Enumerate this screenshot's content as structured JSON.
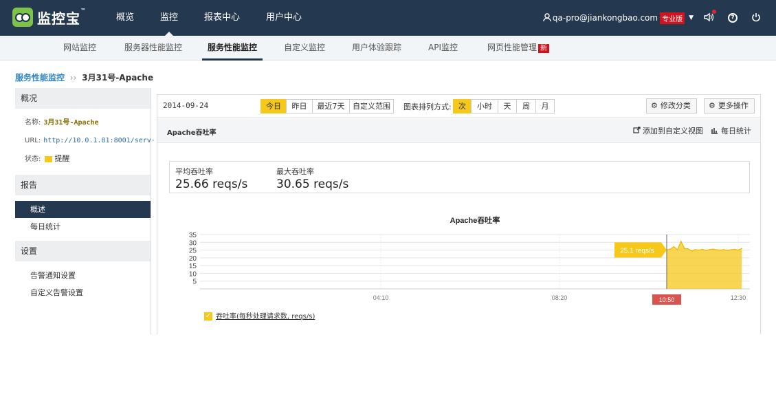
{
  "app": {
    "logo_text": "监控宝",
    "logo_tm": "™",
    "main_nav": [
      "概览",
      "监控",
      "报表中心",
      "用户中心"
    ],
    "main_nav_active": "监控",
    "user_email": "qa-pro@jiankongbao.com",
    "edition_badge": "专业版",
    "help_icon_char": "?"
  },
  "sub_nav": {
    "items": [
      "网站监控",
      "服务器性能监控",
      "服务性能监控",
      "自定义监控",
      "用户体验跟踪",
      "API监控",
      "网页性能管理"
    ],
    "active": "服务性能监控",
    "new_badge": "新"
  },
  "breadcrumb": {
    "parent": "服务性能监控",
    "separator": "››",
    "current": "3月31号-Apache"
  },
  "sidebar": {
    "overview_head": "概况",
    "name_label": "名称:",
    "name_value": "3月31号-Apache",
    "url_label": "URL:",
    "url_value": "http://10.0.1.81:8001/serv···",
    "status_label": "状态:",
    "status_value": "提醒",
    "status_color": "#f5c81a",
    "report_head": "报告",
    "report_items": [
      "概述",
      "每日统计"
    ],
    "report_active": "概述",
    "settings_head": "设置",
    "settings_items": [
      "告警通知设置",
      "自定义告警设置"
    ]
  },
  "toolbar": {
    "date": "2014-09-24",
    "ranges": [
      "今日",
      "昨日",
      "最近7天",
      "自定义范围"
    ],
    "range_active": "今日",
    "sort_label": "图表排列方式:",
    "sort_options": [
      "次",
      "小时",
      "天",
      "周",
      "月"
    ],
    "sort_active": "次",
    "edit_category": "修改分类",
    "more_actions": "更多操作"
  },
  "panel": {
    "title": "Apache吞吐率",
    "add_view": "添加到自定义视图",
    "daily_stats": "每日统计"
  },
  "stats": {
    "avg_label": "平均吞吐率",
    "avg_value": "25.66 reqs/s",
    "max_label": "最大吞吐率",
    "max_value": "30.65 reqs/s"
  },
  "accent_color": "#f5c81a",
  "nav_color": "#24384f",
  "chart_data": {
    "type": "area",
    "title": "Apache吞吐率",
    "yticks": [
      35,
      30,
      25,
      20,
      15,
      10,
      5
    ],
    "ylim": [
      0,
      35
    ],
    "xtick_labels": [
      "04:10",
      "08:20",
      "12:30"
    ],
    "cursor_label": "10:50",
    "tooltip": "25.1 reqs/s",
    "legend": "吞吐率(每秒处理请求数, reqs/s)",
    "series": [
      {
        "x": [
          "10:50",
          "10:55",
          "11:00",
          "11:05",
          "11:10",
          "11:15",
          "11:20",
          "11:25",
          "11:30",
          "11:35",
          "11:40",
          "11:45",
          "11:50",
          "11:55",
          "12:00",
          "12:05",
          "12:10",
          "12:15",
          "12:20",
          "12:25",
          "12:30",
          "12:35"
        ],
        "values": [
          25.1,
          25.6,
          27.2,
          25.2,
          30.6,
          26.0,
          25.8,
          24.4,
          25.3,
          25.0,
          25.5,
          24.7,
          25.4,
          25.6,
          25.2,
          25.0,
          25.3,
          24.8,
          25.2,
          25.5,
          25.0,
          26.0
        ]
      }
    ]
  }
}
